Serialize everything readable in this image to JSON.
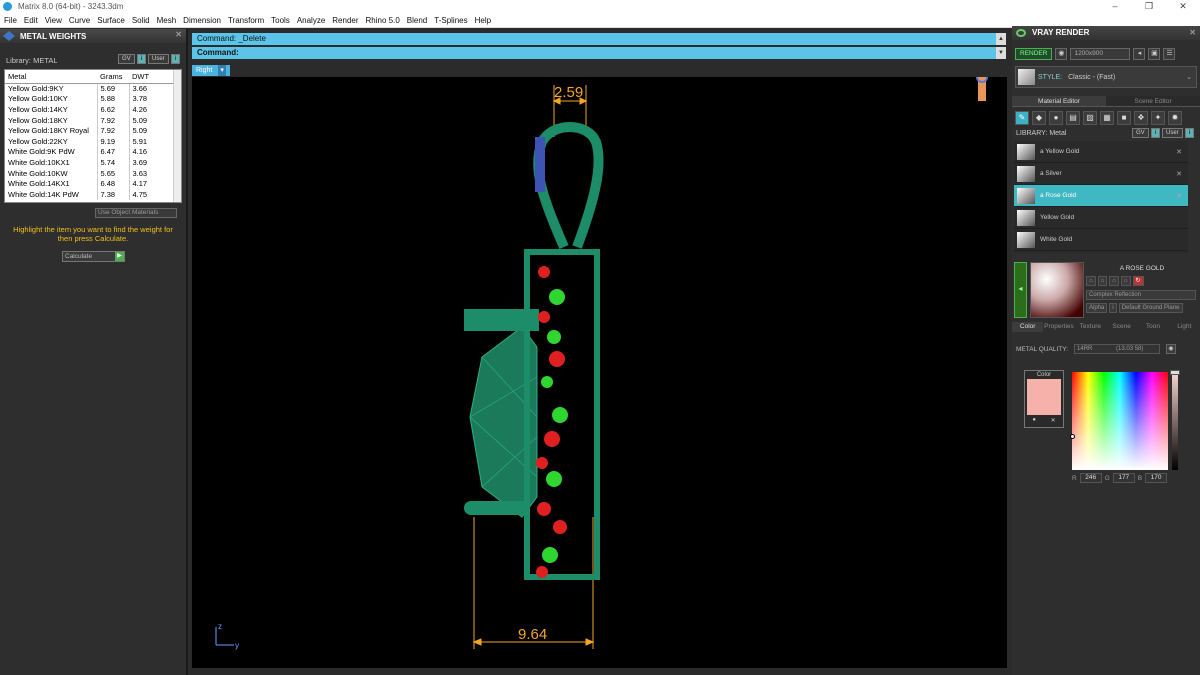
{
  "titlebar": {
    "title": "Matrix 8.0 (64-bit) - 3243.3dm",
    "minimize": "–",
    "maximize": "❐",
    "close": "✕"
  },
  "menu": [
    "File",
    "Edit",
    "View",
    "Curve",
    "Surface",
    "Solid",
    "Mesh",
    "Dimension",
    "Transform",
    "Tools",
    "Analyze",
    "Render",
    "Rhino 5.0",
    "Blend",
    "T-Splines",
    "Help"
  ],
  "left_panel": {
    "title": "METAL WEIGHTS",
    "library_label": "Library: METAL",
    "gv_label": "GV",
    "user_label": "User",
    "columns": [
      "Metal",
      "Grams",
      "DWT"
    ],
    "rows": [
      [
        "Yellow Gold:9KY",
        "5.69",
        "3.66"
      ],
      [
        "Yellow Gold:10KY",
        "5.88",
        "3.78"
      ],
      [
        "Yellow Gold:14KY",
        "6.62",
        "4.26"
      ],
      [
        "Yellow Gold:18KY",
        "7.92",
        "5.09"
      ],
      [
        "Yellow Gold:18KY Royal",
        "7.92",
        "5.09"
      ],
      [
        "Yellow Gold:22KY",
        "9.19",
        "5.91"
      ],
      [
        "White Gold:9K PdW",
        "6.47",
        "4.16"
      ],
      [
        "White Gold:10KX1",
        "5.74",
        "3.69"
      ],
      [
        "White Gold:10KW",
        "5.65",
        "3.63"
      ],
      [
        "White Gold:14KX1",
        "6.48",
        "4.17"
      ],
      [
        "White Gold:14K PdW",
        "7.38",
        "4.75"
      ]
    ],
    "use_object_materials": "Use Object Materials",
    "hint": "Highlight the item you want to find the weight for then press Calculate.",
    "calculate": "Calculate"
  },
  "command": {
    "line1": "Command: _Delete",
    "line2": "Command:"
  },
  "viewport": {
    "name": "Right",
    "dim_top": "2.59",
    "dim_bottom": "9.64",
    "axis_z": "z",
    "axis_y": "y"
  },
  "right_panel": {
    "title": "VRAY RENDER",
    "render_btn": "RENDER",
    "resolution": "1200x900",
    "style_label": "STYLE:",
    "style_value": "Classic - (Fast)",
    "tabs": [
      "Material Editor",
      "Scene Editor"
    ],
    "library_label": "LIBRARY: Metal",
    "gv_label": "GV",
    "user_label": "User",
    "materials": [
      {
        "name": "a Yellow Gold",
        "selected": false,
        "x": "✕"
      },
      {
        "name": "a Silver",
        "selected": false,
        "x": "✕"
      },
      {
        "name": "a Rose Gold",
        "selected": true,
        "x": "✕"
      },
      {
        "name": "Yellow Gold",
        "selected": false,
        "x": ""
      },
      {
        "name": "White Gold",
        "selected": false,
        "x": ""
      }
    ],
    "preview_title": "A ROSE GOLD",
    "reflection": "Complex Reflection",
    "alpha_label": "Alpha",
    "ground_plane": "Default Ground Plane",
    "prop_tabs": [
      "Color",
      "Properties",
      "Texture",
      "Scene",
      "Toon",
      "Light"
    ],
    "metal_quality_label": "METAL QUALITY:",
    "metal_quality_value": "14RR",
    "metal_quality_weight": "(13.03 58)",
    "color_label": "Color",
    "swatch": "#f6b1aa",
    "rgb": {
      "r": "246",
      "g": "177",
      "b": "170"
    }
  }
}
